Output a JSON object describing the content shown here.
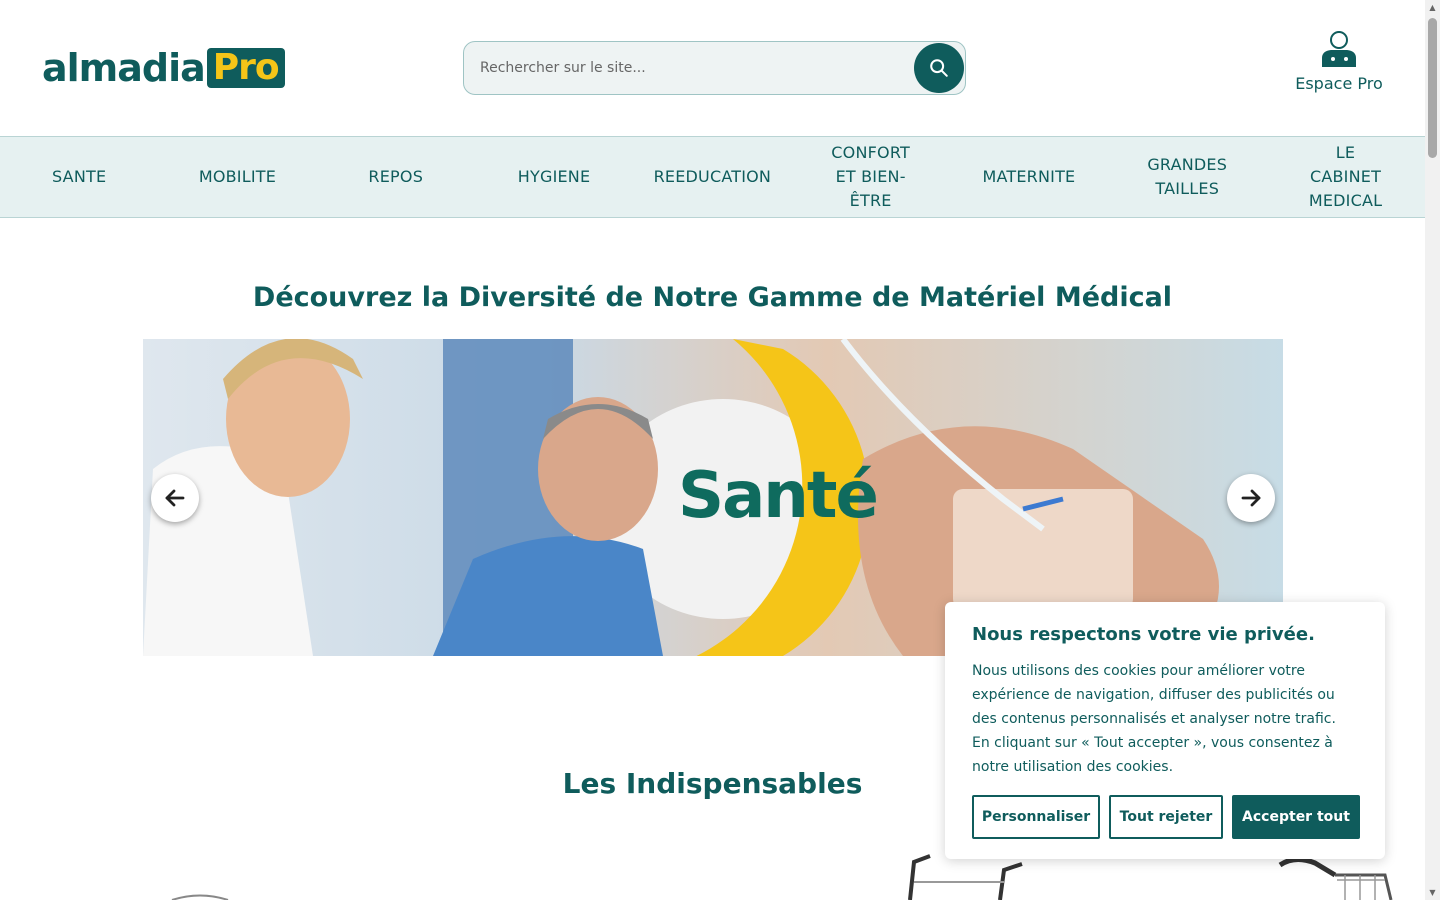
{
  "header": {
    "logo_main": "almadia",
    "logo_pro": "Pro",
    "search_placeholder": "Rechercher sur le site...",
    "espace_pro_label": "Espace Pro"
  },
  "nav": {
    "items": [
      {
        "label": "SANTE"
      },
      {
        "label": "MOBILITE"
      },
      {
        "label": "REPOS"
      },
      {
        "label": "HYGIENE"
      },
      {
        "label": "REEDUCATION"
      },
      {
        "label": "CONFORT\nET BIEN-\nÊTRE"
      },
      {
        "label": "MATERNITE"
      },
      {
        "label": "GRANDES\nTAILLES"
      },
      {
        "label": "LE\nCABINET\nMEDICAL"
      }
    ]
  },
  "main": {
    "hero_title": "Découvrez la Diversité de Notre Gamme de Matériel Médical",
    "slide_label": "Santé",
    "section_title": "Les Indispensables"
  },
  "cookie": {
    "title": "Nous respectons votre vie privée.",
    "text": "Nous utilisons des cookies pour améliorer votre expérience de navigation, diffuser des publicités ou des contenus personnalisés et analyser notre trafic. En cliquant sur « Tout accepter », vous consentez à notre utilisation des cookies.",
    "customize_label": "Personnaliser",
    "reject_label": "Tout rejeter",
    "accept_label": "Accepter tout"
  },
  "colors": {
    "brand": "#0f5c5c",
    "accent": "#f5c518",
    "nav_bg": "#e6f1f1"
  }
}
